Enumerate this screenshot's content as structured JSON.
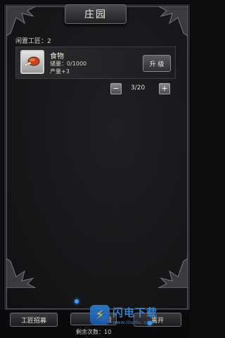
{
  "header": {
    "title": "庄园"
  },
  "idle_workers": "闲置工匠：2",
  "item": {
    "name": "食物",
    "storage": "储量：0/1000",
    "output": "产量+3",
    "icon": "meat-drumstick-icon",
    "upgrade_label": "升 级"
  },
  "stepper": {
    "minus": "−",
    "value": "3/20",
    "plus": "+"
  },
  "footer": {
    "recruit_label": "工匠招募",
    "collect_label": "收益",
    "leave_label": "离开",
    "remaining": "剩余次数：10"
  },
  "watermark": {
    "name": "闪电下载",
    "url": "www.dianlu..com"
  },
  "colors": {
    "accent_blue": "#3a8de0",
    "lightning": "#ffd23a"
  }
}
